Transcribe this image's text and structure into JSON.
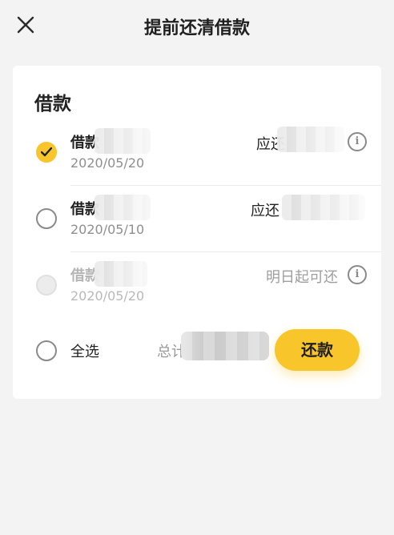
{
  "header": {
    "title": "提前还清借款"
  },
  "card": {
    "section_title": "借款"
  },
  "loans": [
    {
      "label": "借款",
      "date": "2020/05/20",
      "due_label": "应还",
      "selected": true,
      "disabled": false
    },
    {
      "label": "借款",
      "date": "2020/05/10",
      "due_label": "应还",
      "selected": false,
      "disabled": false
    },
    {
      "label": "借款",
      "date": "2020/05/20",
      "due_label": "明日起可还",
      "selected": false,
      "disabled": true
    }
  ],
  "footer": {
    "select_all_label": "全选",
    "total_label": "总计",
    "repay_button": "还款"
  },
  "colors": {
    "accent": "#f8c62b",
    "background": "#f3f3f3",
    "card": "#ffffff",
    "muted_text": "#b5b5b5"
  },
  "icons": {
    "close": "close-icon",
    "info": "info-icon",
    "check": "check-icon"
  }
}
